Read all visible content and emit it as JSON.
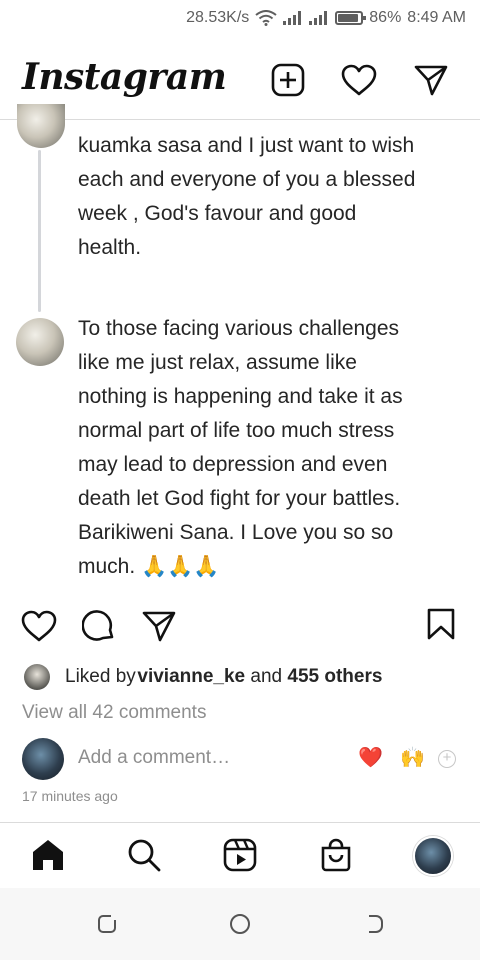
{
  "status_bar": {
    "net_speed": "28.53K/s",
    "battery": "86%",
    "time": "8:49 AM"
  },
  "header": {
    "logo": "Instagram",
    "icons": [
      "new-post-icon",
      "heart-icon",
      "direct-message-icon"
    ]
  },
  "thread": {
    "reply_1_text": "kuamka sasa and I just want to wish\neach and everyone of you a blessed\nweek , God's favour and good\nhealth.",
    "reply_2_text": "To those facing various challenges\nlike me just relax, assume like\nnothing is happening and take it as\nnormal part of life too much stress\nmay lead to depression and even\ndeath let God fight for your battles.\nBarikiweni Sana. I Love you so so\nmuch. 🙏🙏🙏"
  },
  "post": {
    "liked_by_prefix": "Liked by ",
    "liked_by_user": "vivianne_ke",
    "liked_by_and": " and ",
    "liked_by_others": "455 others",
    "view_comments": "View all 42 comments",
    "comment_placeholder": "Add a comment…",
    "quick_emojis": [
      "❤️",
      "🙌"
    ],
    "timestamp": "17 minutes ago"
  },
  "bottom_nav": {
    "items": [
      "home-icon",
      "search-icon",
      "reels-icon",
      "shop-icon",
      "profile-avatar"
    ]
  },
  "colors": {
    "text": "#262626",
    "secondary": "#8e8e8e",
    "divider": "#dbdbdb",
    "like_red": "#ed4956"
  }
}
